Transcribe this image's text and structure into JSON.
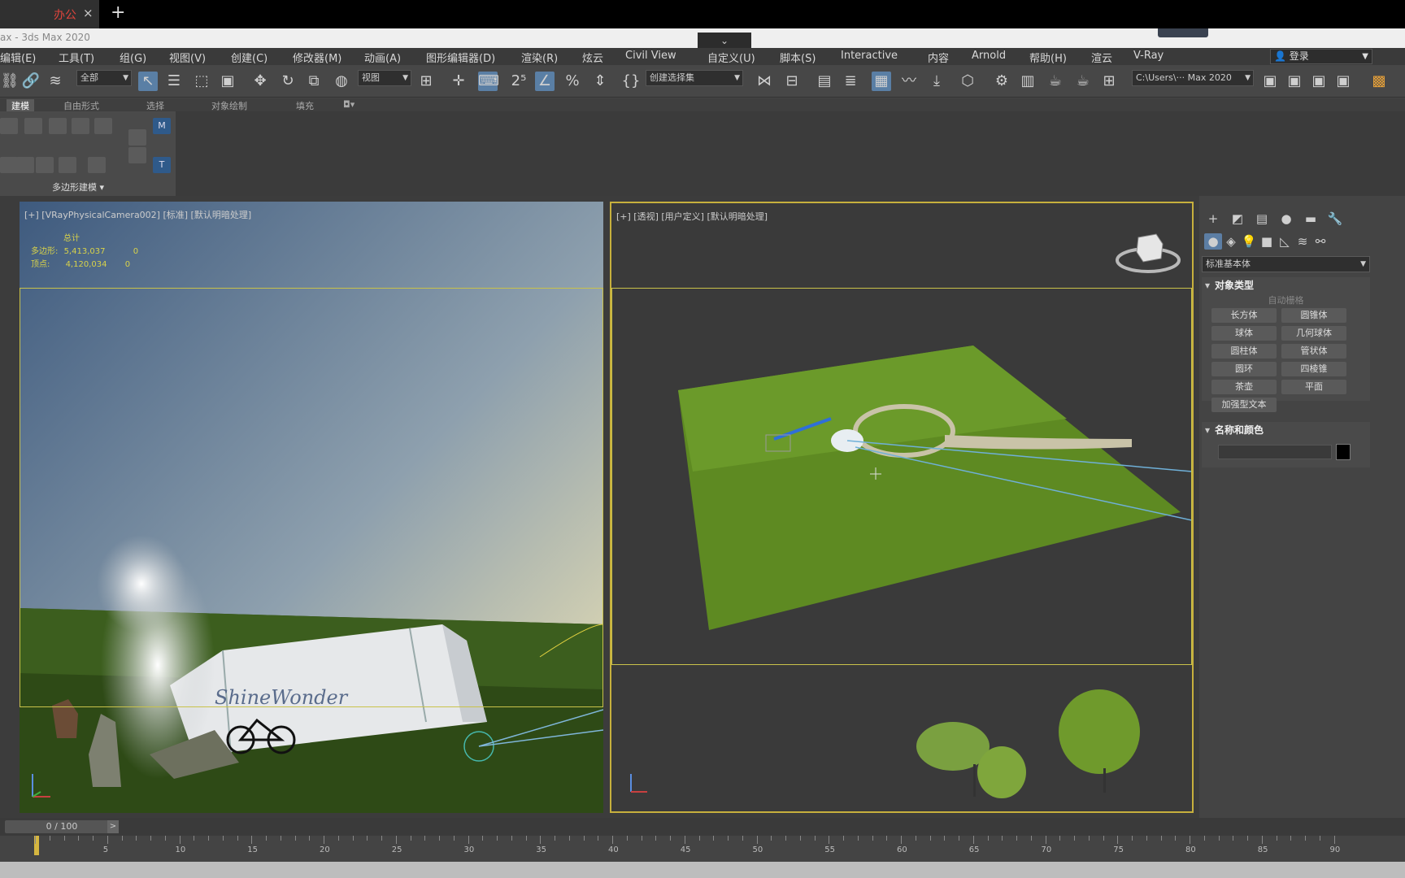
{
  "tabs": [
    {
      "label": "办公",
      "close": "×"
    }
  ],
  "tab_add": "+",
  "window_title": "ax - 3ds Max 2020",
  "collapse_glyph": "⌄",
  "menu": [
    "编辑(E)",
    "工具(T)",
    "组(G)",
    "视图(V)",
    "创建(C)",
    "修改器(M)",
    "动画(A)",
    "图形编辑器(D)",
    "渲染(R)",
    "炫云",
    "Civil View",
    "自定义(U)",
    "脚本(S)",
    "Interactive",
    "内容",
    "Arnold",
    "帮助(H)",
    "渲云",
    "V-Ray"
  ],
  "login": {
    "label": "登录",
    "user_icon": "user-icon"
  },
  "toolbar": {
    "selection_filter": "全部",
    "ref_coord": "视图",
    "named_selection": "创建选择集",
    "path": "C:\\Users\\··· Max 2020",
    "icons": [
      "link-icon",
      "unlink-icon",
      "bind-space-warp-icon",
      "select-object-icon",
      "select-by-name-icon",
      "rect-select-icon",
      "window-crossing-icon",
      "move-icon",
      "rotate-icon",
      "scale-icon",
      "placement-icon",
      "pivot-icon",
      "manipulate-icon",
      "snap-2.5-icon",
      "angle-snap-icon",
      "percent-snap-icon",
      "spinner-snap-icon",
      "edit-named-sets-icon",
      "mirror-icon",
      "align-icon",
      "scene-explorer-icon",
      "layer-explorer-icon",
      "ribbon-toggle-icon",
      "curve-editor-icon",
      "schematic-view-icon",
      "material-editor-icon",
      "render-setup-icon",
      "rendered-frame-icon",
      "render-icon",
      "render-iterative-icon"
    ]
  },
  "ribbon": {
    "tabs": [
      "建模",
      "自由形式",
      "选择",
      "对象绘制",
      "填充"
    ],
    "active_tab": 0,
    "panel_label": "多边形建模"
  },
  "viewports": {
    "left": {
      "label": "[+] [VRayPhysicalCamera002] [标准] [默认明暗处理]",
      "stats": {
        "header": "总计",
        "polys_label": "多边形:",
        "polys_value": "5,413,037",
        "polys_sel": "0",
        "verts_label": "顶点:",
        "verts_value": "4,120,034",
        "verts_sel": "0"
      },
      "scene_text": "ShineWonder"
    },
    "right": {
      "label": "[+] [透视] [用户定义] [默认明暗处理]"
    }
  },
  "command_panel": {
    "tab_icons": [
      "create-icon",
      "modify-icon",
      "hierarchy-icon",
      "motion-icon",
      "display-icon",
      "utilities-icon"
    ],
    "sub_icons": [
      "geometry-icon",
      "shapes-icon",
      "lights-icon",
      "cameras-icon",
      "helpers-icon",
      "space-warps-icon",
      "systems-icon"
    ],
    "category": "标准基本体",
    "object_type_title": "对象类型",
    "autogrid": "自动栅格",
    "objects": [
      "长方体",
      "圆锥体",
      "球体",
      "几何球体",
      "圆柱体",
      "管状体",
      "圆环",
      "四棱锥",
      "茶壶",
      "平面",
      "加强型文本"
    ],
    "name_color_title": "名称和颜色"
  },
  "timeline": {
    "position": "0 / 100",
    "next": ">",
    "ticks": [
      "5",
      "10",
      "15",
      "20",
      "25",
      "30",
      "35",
      "40",
      "45",
      "50",
      "55",
      "60",
      "65",
      "70",
      "75",
      "80",
      "85",
      "90"
    ]
  },
  "colors": {
    "accent": "#5a7fa5",
    "active_viewport_border": "#c7b03d",
    "stats_text": "#d8d24a",
    "grass": "#5e8a22"
  }
}
